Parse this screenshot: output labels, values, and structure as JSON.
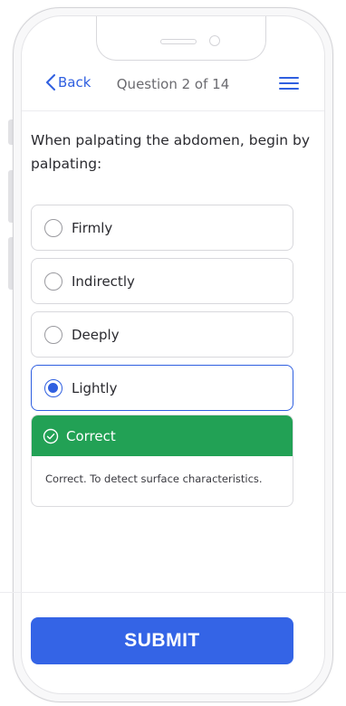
{
  "header": {
    "back_label": "Back",
    "title": "Question 2 of 14"
  },
  "question": {
    "text": "When palpating the abdomen, begin by palpating:",
    "options": [
      {
        "label": "Firmly",
        "selected": false
      },
      {
        "label": "Indirectly",
        "selected": false
      },
      {
        "label": "Deeply",
        "selected": false
      },
      {
        "label": "Lightly",
        "selected": true
      }
    ]
  },
  "feedback": {
    "status": "Correct",
    "message": "Correct. To detect surface characteristics.",
    "color": "#22a155"
  },
  "actions": {
    "submit_label": "SUBMIT"
  },
  "colors": {
    "accent": "#2f5fe0",
    "submit": "#3464e6"
  },
  "icons": {
    "back": "chevron-left-icon",
    "menu": "hamburger-menu-icon",
    "status": "check-circle-icon"
  }
}
